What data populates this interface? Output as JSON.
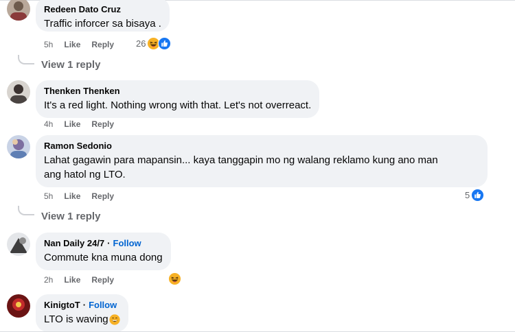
{
  "comments": [
    {
      "author": "Redeen Dato Cruz",
      "text": "Traffic inforcer sa bisaya .",
      "time": "5h",
      "like": "Like",
      "reply": "Reply",
      "reaction_count": "26",
      "view_replies": "View 1 reply"
    },
    {
      "author": "Thenken Thenken",
      "text": "It's a red light. Nothing wrong with that. Let's not overreact.",
      "time": "4h",
      "like": "Like",
      "reply": "Reply"
    },
    {
      "author": "Ramon Sedonio",
      "text_line1": "Lahat gagawin para mapansin... kaya tanggapin mo ng walang reklamo kung ano man",
      "text_line2": "ang hatol ng LTO.",
      "time": "5h",
      "like": "Like",
      "reply": "Reply",
      "reaction_count": "5",
      "view_replies": "View 1 reply"
    },
    {
      "author": "Nan Daily 24/7",
      "follow": "Follow",
      "separator": "·",
      "text": "Commute kna muna dong",
      "time": "2h",
      "like": "Like",
      "reply": "Reply"
    },
    {
      "author": "KinigtoT",
      "follow": "Follow",
      "separator": "·",
      "text": "LTO is waving"
    }
  ],
  "icons": {
    "haha": "laughing-emoji-icon",
    "like": "thumbs-up-icon"
  },
  "colors": {
    "bubble": "#f0f2f5",
    "meta": "#65676b",
    "follow": "#0064d1",
    "like_blue": "#1877f2",
    "haha_yellow": "#f7b125"
  }
}
